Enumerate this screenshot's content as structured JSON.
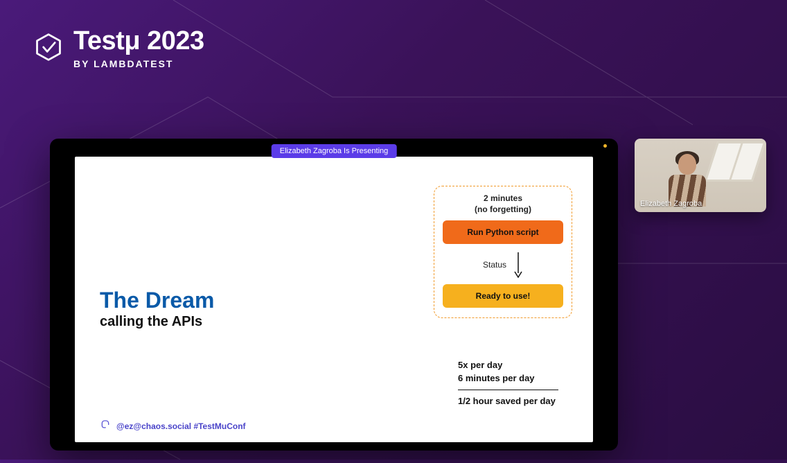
{
  "event": {
    "title": "Testμ 2023",
    "byline": "BY LAMBDATEST"
  },
  "presenting_badge": "Elizabeth Zagroba Is Presenting",
  "slide": {
    "title": "The Dream",
    "subtitle": "calling the APIs",
    "diagram": {
      "top_line1": "2 minutes",
      "top_line2": "(no forgetting)",
      "step1": "Run Python script",
      "arrow_label": "Status",
      "step2": "Ready to use!"
    },
    "stats": {
      "line1": "5x per day",
      "line2": "6 minutes per day",
      "result": "1/2 hour saved per day"
    },
    "footer_handle": "@ez@chaos.social #TestMuConf"
  },
  "speaker": {
    "name": "Elizabeth Zagroba"
  }
}
